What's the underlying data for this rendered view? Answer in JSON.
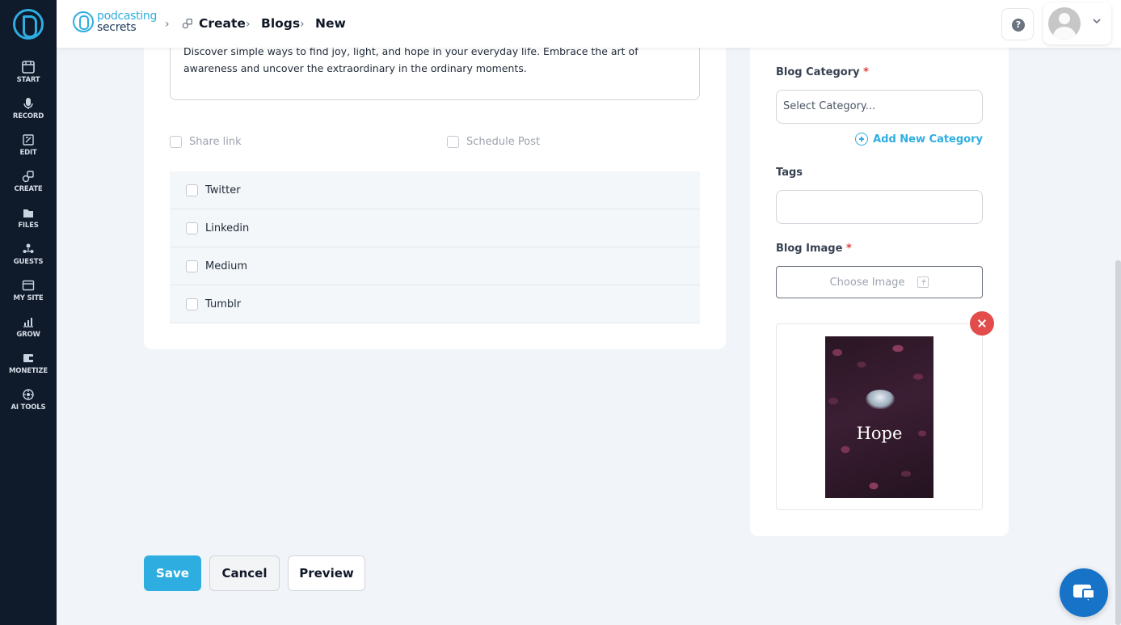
{
  "sidebar": {
    "items": [
      {
        "label": "START",
        "icon": "start-icon"
      },
      {
        "label": "RECORD",
        "icon": "microphone-icon"
      },
      {
        "label": "EDIT",
        "icon": "edit-icon"
      },
      {
        "label": "CREATE",
        "icon": "create-icon"
      },
      {
        "label": "FILES",
        "icon": "files-icon"
      },
      {
        "label": "GUESTS",
        "icon": "guests-icon"
      },
      {
        "label": "MY SITE",
        "icon": "site-icon"
      },
      {
        "label": "GROW",
        "icon": "grow-chart-icon"
      },
      {
        "label": "MONETIZE",
        "icon": "monetize-icon"
      },
      {
        "label": "AI TOOLS",
        "icon": "ai-tools-icon"
      }
    ]
  },
  "header": {
    "logo_line1": "podcasting",
    "logo_line2": "secrets",
    "breadcrumb": [
      "Create",
      "Blogs",
      "New"
    ],
    "help_glyph": "?"
  },
  "form": {
    "description": "Discover simple ways to find joy, light, and hope in your everyday life. Embrace the art of awareness and uncover the extraordinary in the ordinary moments.",
    "share_link_label": "Share link",
    "schedule_post_label": "Schedule Post",
    "socials": [
      "Twitter",
      "Linkedin",
      "Medium",
      "Tumblr"
    ]
  },
  "sidebar_form": {
    "category_label": "Blog Category",
    "required_mark": "*",
    "category_placeholder": "Select Category...",
    "add_category_label": "Add New Category",
    "tags_label": "Tags",
    "image_label": "Blog Image",
    "choose_image_label": "Choose Image",
    "image_preview_title": "Hope"
  },
  "actions": {
    "save": "Save",
    "cancel": "Cancel",
    "preview": "Preview"
  },
  "colors": {
    "accent": "#2eaee0",
    "sidebar_bg": "#0f1a2b",
    "danger": "#e24c4b",
    "chat": "#1673c8"
  }
}
